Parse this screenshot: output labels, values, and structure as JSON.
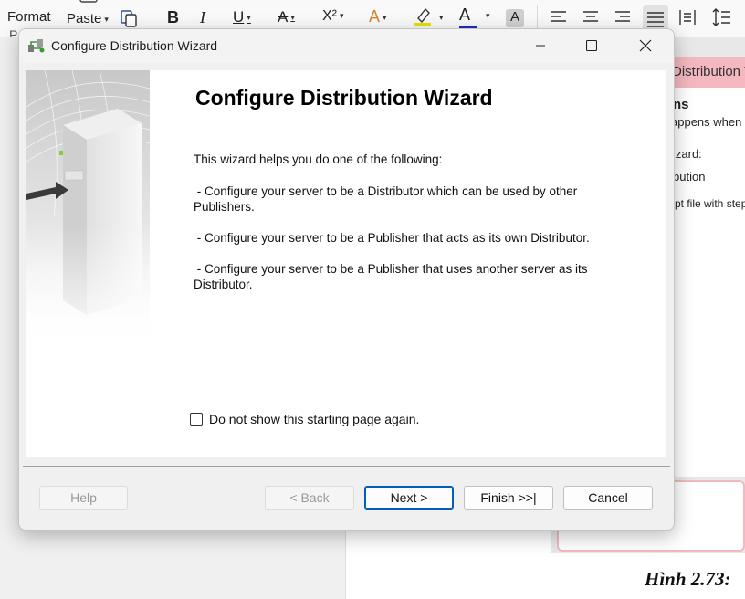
{
  "ribbon": {
    "format_label": "Format",
    "paste_label": "Paste",
    "bold_glyph": "B",
    "italic_glyph": "I",
    "underline_glyph": "U",
    "strike_glyph": "A",
    "superscript_glyph": "X²",
    "fontcolor_glyph": "A",
    "highlight_glyph": "A",
    "shade_glyph": "A",
    "clipped_letter": "P"
  },
  "background_doc": {
    "pink_title": "Distribution Wizard",
    "heading_fragment": "ns",
    "line1": "appens when y",
    "line2": "izard:",
    "line3": "bution",
    "line4": "pt file with step",
    "caption": "Hình 2.73:"
  },
  "dialog": {
    "title": "Configure Distribution Wizard",
    "heading": "Configure Distribution Wizard",
    "intro": "This wizard helps you do one of the following:",
    "options": [
      " - Configure your server to be a Distributor which can be used by other Publishers.",
      " - Configure your server to be a Publisher that acts as its own Distributor.",
      " - Configure your server to be a Publisher that uses another server as its Distributor."
    ],
    "checkbox_label": "Do not show this starting page again.",
    "checkbox_checked": false,
    "buttons": {
      "help": "Help",
      "back": "< Back",
      "next": "Next >",
      "finish": "Finish >>|",
      "cancel": "Cancel"
    }
  },
  "colors": {
    "accent": "#005fb8",
    "pink": "#f4b8c0"
  }
}
